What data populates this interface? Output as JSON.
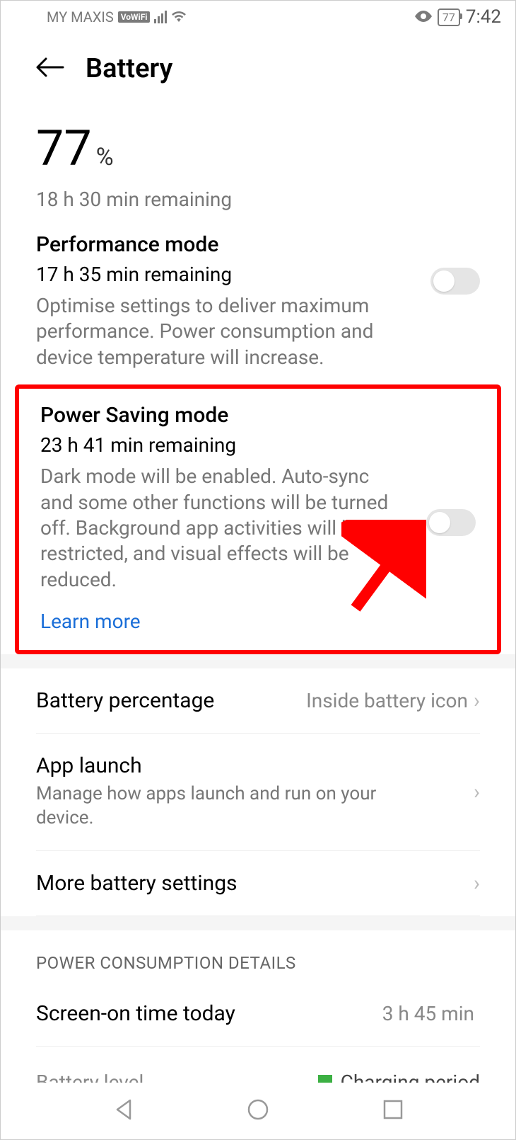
{
  "status": {
    "carrier": "MY MAXIS",
    "vowifi": "VoWiFi",
    "battery_pct": "77",
    "time": "7:42"
  },
  "header": {
    "title": "Battery"
  },
  "battery": {
    "value": "77",
    "unit": "%",
    "remaining": "18 h 30 min remaining"
  },
  "performance_mode": {
    "title": "Performance mode",
    "remaining": "17 h 35 min remaining",
    "desc": "Optimise settings to deliver maximum performance. Power consumption and device temperature will increase.",
    "toggle": false
  },
  "power_saving_mode": {
    "title": "Power Saving mode",
    "remaining": "23 h 41 min remaining",
    "desc": "Dark mode will be enabled. Auto-sync and some other functions will be turned off. Background app activities will be restricted, and visual effects will be reduced.",
    "learn_more": "Learn more",
    "toggle": false
  },
  "rows": {
    "battery_percentage": {
      "title": "Battery percentage",
      "value": "Inside battery icon"
    },
    "app_launch": {
      "title": "App launch",
      "desc": "Manage how apps launch and run on your device."
    },
    "more_settings": {
      "title": "More battery settings"
    }
  },
  "consumption": {
    "header": "POWER CONSUMPTION DETAILS",
    "screen_on": {
      "title": "Screen-on time today",
      "value": "3 h 45 min"
    },
    "legend": {
      "left": "Battery level",
      "right": "Charging period"
    }
  }
}
